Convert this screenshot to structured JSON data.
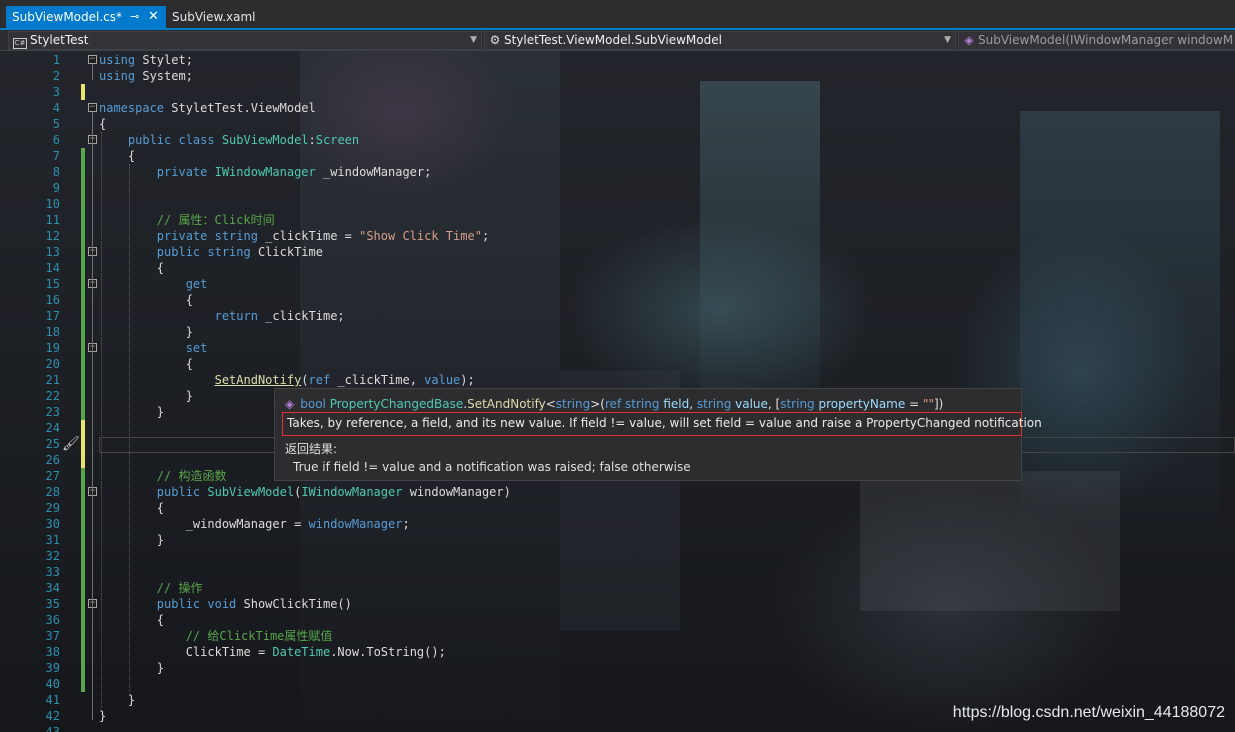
{
  "tabs": [
    {
      "label": "SubViewModel.cs*",
      "active": true,
      "pin_icon": "pin-icon",
      "close_icon": "close-icon"
    },
    {
      "label": "SubView.xaml",
      "active": false
    }
  ],
  "navigation": {
    "project": "StyletTest",
    "type": "StyletTest.ViewModel.SubViewModel",
    "member": "SubViewModel(IWindowManager windowM"
  },
  "colors": {
    "accent": "#007acc",
    "keyword": "#569cd6",
    "type": "#4ec9b0",
    "string": "#d69d85",
    "comment": "#57a64a",
    "line_number": "#2b91af",
    "saved_change": "#57a64a",
    "unsaved_change": "#e8e36b",
    "highlight_border": "#e03131"
  },
  "lines": [
    {
      "num": "1",
      "tokens": [
        [
          "kw",
          "using"
        ],
        [
          "tx",
          " Stylet;"
        ]
      ]
    },
    {
      "num": "2",
      "tokens": [
        [
          "kw",
          "using"
        ],
        [
          "tx",
          " System;"
        ]
      ]
    },
    {
      "num": "3",
      "tokens": []
    },
    {
      "num": "4",
      "tokens": [
        [
          "kw",
          "namespace"
        ],
        [
          "tx",
          " StyletTest.ViewModel"
        ]
      ]
    },
    {
      "num": "5",
      "tokens": [
        [
          "tx",
          "{"
        ]
      ]
    },
    {
      "num": "6",
      "tokens": [
        [
          "kw",
          "    public class "
        ],
        [
          "ty",
          "SubViewModel"
        ],
        [
          "tx",
          ":"
        ],
        [
          "ty",
          "Screen"
        ]
      ]
    },
    {
      "num": "7",
      "tokens": [
        [
          "tx",
          "    {"
        ]
      ]
    },
    {
      "num": "8",
      "tokens": [
        [
          "kw",
          "        private "
        ],
        [
          "ty",
          "IWindowManager"
        ],
        [
          "tx",
          " _windowManager;"
        ]
      ]
    },
    {
      "num": "9",
      "tokens": []
    },
    {
      "num": "10",
      "tokens": []
    },
    {
      "num": "11",
      "tokens": [
        [
          "cm",
          "        // 属性：Click时间"
        ]
      ]
    },
    {
      "num": "12",
      "tokens": [
        [
          "kw",
          "        private string"
        ],
        [
          "tx",
          " _clickTime = "
        ],
        [
          "st",
          "\"Show Click Time\""
        ],
        [
          "tx",
          ";"
        ]
      ]
    },
    {
      "num": "13",
      "tokens": [
        [
          "kw",
          "        public string"
        ],
        [
          "tx",
          " ClickTime"
        ]
      ]
    },
    {
      "num": "14",
      "tokens": [
        [
          "tx",
          "        {"
        ]
      ]
    },
    {
      "num": "15",
      "tokens": [
        [
          "kw",
          "            get"
        ]
      ]
    },
    {
      "num": "16",
      "tokens": [
        [
          "tx",
          "            {"
        ]
      ]
    },
    {
      "num": "17",
      "tokens": [
        [
          "kw",
          "                return"
        ],
        [
          "tx",
          " _clickTime;"
        ]
      ]
    },
    {
      "num": "18",
      "tokens": [
        [
          "tx",
          "            }"
        ]
      ]
    },
    {
      "num": "19",
      "tokens": [
        [
          "kw",
          "            set"
        ]
      ]
    },
    {
      "num": "20",
      "tokens": [
        [
          "tx",
          "            {"
        ]
      ]
    },
    {
      "num": "21",
      "tokens": [
        [
          "tx",
          "                "
        ],
        [
          "meu",
          "SetAndNotify"
        ],
        [
          "tx",
          "("
        ],
        [
          "kw",
          "ref"
        ],
        [
          "tx",
          " _clickTime, "
        ],
        [
          "kw",
          "value"
        ],
        [
          "tx",
          ");"
        ]
      ]
    },
    {
      "num": "22",
      "tokens": [
        [
          "tx",
          "            }"
        ]
      ]
    },
    {
      "num": "23",
      "tokens": [
        [
          "tx",
          "        }"
        ]
      ]
    },
    {
      "num": "24",
      "tokens": []
    },
    {
      "num": "25",
      "tokens": []
    },
    {
      "num": "26",
      "tokens": []
    },
    {
      "num": "27",
      "tokens": [
        [
          "cm",
          "        // 构造函数"
        ]
      ]
    },
    {
      "num": "28",
      "tokens": [
        [
          "kw",
          "        public "
        ],
        [
          "ty",
          "SubViewModel"
        ],
        [
          "tx",
          "("
        ],
        [
          "ty",
          "IWindowManager"
        ],
        [
          "tx",
          " windowManager)"
        ]
      ]
    },
    {
      "num": "29",
      "tokens": [
        [
          "tx",
          "        {"
        ]
      ]
    },
    {
      "num": "30",
      "tokens": [
        [
          "tx",
          "            _windowManager = "
        ],
        [
          "kw",
          "windowManager"
        ],
        [
          "tx",
          ";"
        ]
      ]
    },
    {
      "num": "31",
      "tokens": [
        [
          "tx",
          "        }"
        ]
      ]
    },
    {
      "num": "32",
      "tokens": []
    },
    {
      "num": "33",
      "tokens": []
    },
    {
      "num": "34",
      "tokens": [
        [
          "cm",
          "        // 操作"
        ]
      ]
    },
    {
      "num": "35",
      "tokens": [
        [
          "kw",
          "        public void"
        ],
        [
          "tx",
          " ShowClickTime()"
        ]
      ]
    },
    {
      "num": "36",
      "tokens": [
        [
          "tx",
          "        {"
        ]
      ]
    },
    {
      "num": "37",
      "tokens": [
        [
          "cm",
          "            // 给ClickTime属性赋值"
        ]
      ]
    },
    {
      "num": "38",
      "tokens": [
        [
          "tx",
          "            ClickTime = "
        ],
        [
          "ty",
          "DateTime"
        ],
        [
          "tx",
          "."
        ],
        [
          "tx",
          "Now"
        ],
        [
          "tx",
          "."
        ],
        [
          "tx",
          "ToString"
        ],
        [
          "tx",
          "();"
        ]
      ]
    },
    {
      "num": "39",
      "tokens": [
        [
          "tx",
          "        }"
        ]
      ]
    },
    {
      "num": "40",
      "tokens": []
    },
    {
      "num": "41",
      "tokens": [
        [
          "tx",
          "    }"
        ]
      ]
    },
    {
      "num": "42",
      "tokens": [
        [
          "tx",
          "}"
        ]
      ]
    },
    {
      "num": "43",
      "tokens": []
    }
  ],
  "tooltip": {
    "signature": [
      [
        "k",
        "bool "
      ],
      [
        "t",
        "PropertyChangedBase"
      ],
      [
        "x",
        "."
      ],
      [
        "m",
        "SetAndNotify"
      ],
      [
        "x",
        "<"
      ],
      [
        "k",
        "string"
      ],
      [
        "x",
        ">("
      ],
      [
        "k",
        "ref string "
      ],
      [
        "p",
        "field"
      ],
      [
        "x",
        ", "
      ],
      [
        "k",
        "string "
      ],
      [
        "p",
        "value"
      ],
      [
        "x",
        ", ["
      ],
      [
        "k",
        "string "
      ],
      [
        "p",
        "propertyName"
      ],
      [
        "x",
        " = "
      ],
      [
        "s",
        "\"\""
      ],
      [
        "x",
        "])"
      ]
    ],
    "summary": "Takes, by reference, a field, and its new value. If field != value, will set field = value and raise a PropertyChanged notification",
    "returns_label": "返回结果:",
    "returns_text": "True if field != value and a notification was raised; false otherwise"
  },
  "watermark": "https://blog.csdn.net/weixin_44188072"
}
